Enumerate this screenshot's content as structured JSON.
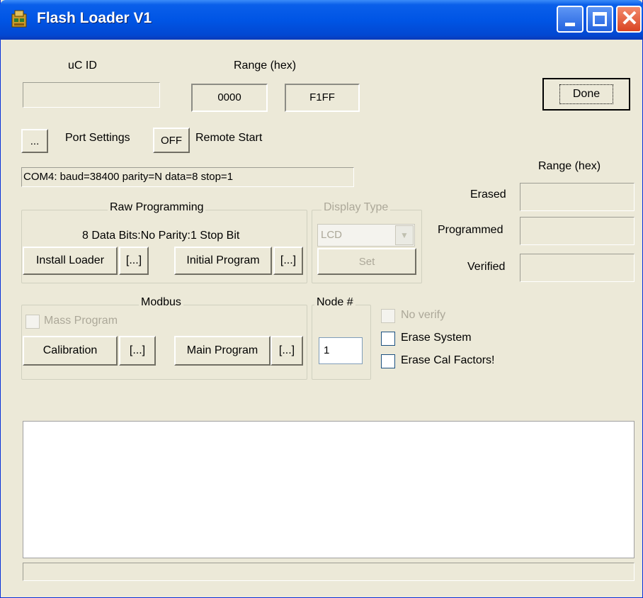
{
  "window": {
    "title": "Flash Loader V1",
    "close_glyph": "✕"
  },
  "header": {
    "uc_id_label": "uC ID",
    "uc_id_value": "",
    "range_label": "Range (hex)",
    "range_start": "0000",
    "range_end": "F1FF",
    "done_label": "Done"
  },
  "port": {
    "ellipsis_label": "...",
    "settings_label": "Port Settings",
    "remote_btn_label": "OFF",
    "remote_label": "Remote Start",
    "status": "COM4: baud=38400 parity=N data=8 stop=1"
  },
  "results": {
    "range_label": "Range (hex)",
    "erased_label": "Erased",
    "erased_value": "",
    "programmed_label": "Programmed",
    "programmed_value": "",
    "verified_label": "Verified",
    "verified_value": ""
  },
  "raw": {
    "title": "Raw Programming",
    "info": "8 Data Bits:No Parity:1 Stop Bit",
    "install_label": "Install Loader",
    "install_browse": "[...]",
    "initial_label": "Initial Program",
    "initial_browse": "[...]"
  },
  "display": {
    "title": "Display Type",
    "selected": "LCD",
    "dropdown_glyph": "▼",
    "set_label": "Set"
  },
  "modbus": {
    "title": "Modbus",
    "mass_label": "Mass Program",
    "calibration_label": "Calibration",
    "calibration_browse": "[...]",
    "main_label": "Main Program",
    "main_browse": "[...]"
  },
  "node": {
    "title": "Node #",
    "value": "1"
  },
  "options": {
    "no_verify": "No verify",
    "erase_system": "Erase System",
    "erase_cal": "Erase Cal Factors!"
  },
  "log": {
    "text": ""
  },
  "status_bar": {
    "text": ""
  },
  "icons": {
    "app": "chip-app-icon",
    "minimize": "minimize-icon",
    "maximize": "maximize-icon",
    "close": "close-icon"
  }
}
